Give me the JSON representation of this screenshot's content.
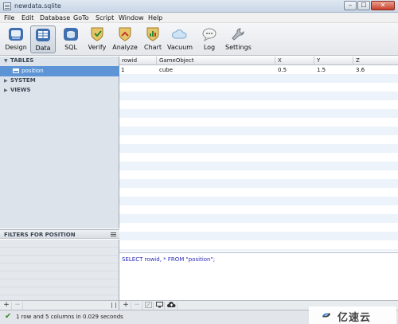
{
  "window": {
    "title": "newdata.sqlite",
    "min": "–",
    "max": "☐",
    "close": "✕"
  },
  "menu": [
    "File",
    "Edit",
    "Database",
    "GoTo",
    "Script",
    "Window",
    "Help"
  ],
  "toolbar": [
    {
      "label": "Design",
      "icon": "design-icon",
      "active": false
    },
    {
      "label": "Data",
      "icon": "data-icon",
      "active": true
    },
    {
      "label": "SQL",
      "icon": "sql-icon",
      "active": false
    },
    {
      "label": "Verify",
      "icon": "verify-shield-icon",
      "active": false
    },
    {
      "label": "Analyze",
      "icon": "analyze-shield-icon",
      "active": false
    },
    {
      "label": "Chart",
      "icon": "chart-shield-icon",
      "active": false
    },
    {
      "label": "Vacuum",
      "icon": "cloud-icon",
      "active": false
    },
    {
      "label": "Log",
      "icon": "speech-bubble-icon",
      "active": false
    },
    {
      "label": "Settings",
      "icon": "wrench-icon",
      "active": false
    }
  ],
  "sidebar": {
    "sections": [
      {
        "label": "TABLES",
        "expanded": true
      },
      {
        "label": "SYSTEM",
        "expanded": false
      },
      {
        "label": "VIEWS",
        "expanded": false
      }
    ],
    "selected_table": "position",
    "filters_label": "FILTERS FOR POSITION"
  },
  "grid": {
    "columns": [
      "rowid",
      "GameObject",
      "X",
      "Y",
      "Z"
    ],
    "rows": [
      [
        "1",
        "cube",
        "0.5",
        "1.5",
        "3.6"
      ]
    ]
  },
  "sql": {
    "query": "SELECT rowid, * FROM \"position\";"
  },
  "bottom": {
    "add": "+",
    "remove": "−",
    "more": "⁞"
  },
  "status": {
    "text": "1 row and 5 columns in 0.029 seconds"
  },
  "watermark": {
    "text": "亿速云"
  },
  "colors": {
    "selection": "#5c94d6",
    "row_alt": "#edf3fb",
    "sidebar_bg": "#dde3ea",
    "sql_text": "#2a2ab8"
  }
}
